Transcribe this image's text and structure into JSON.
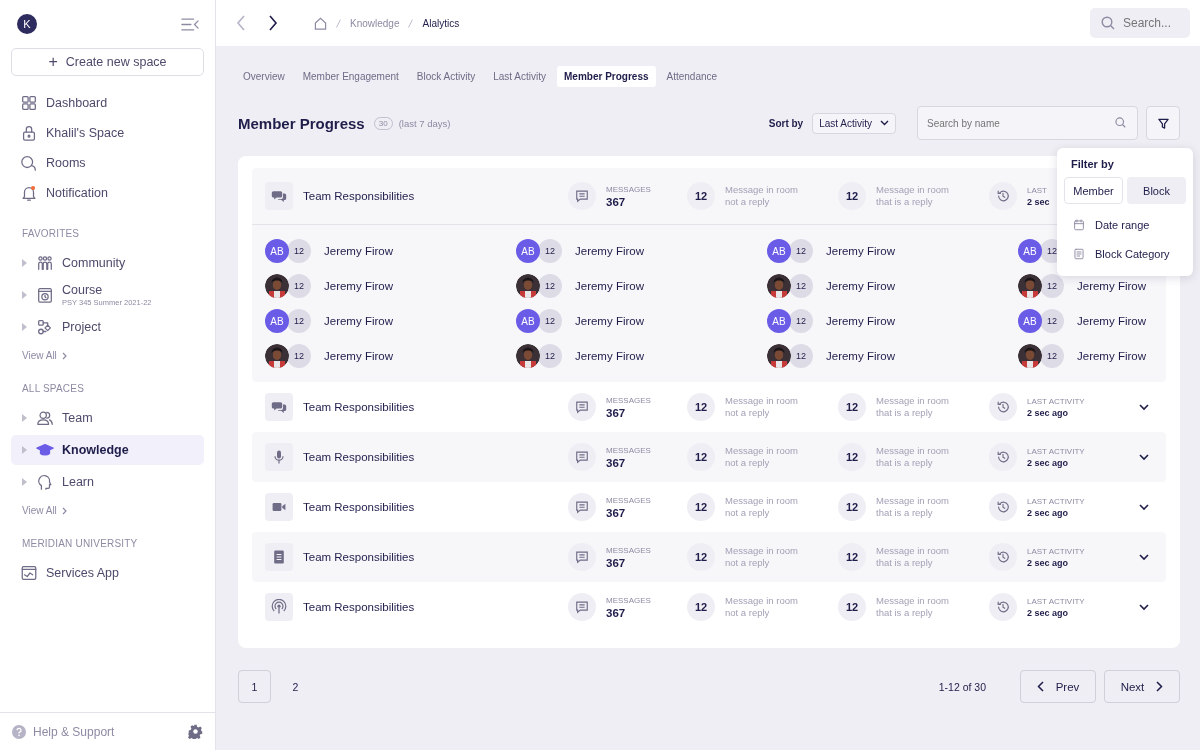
{
  "sidebar": {
    "avatar": "K",
    "create_button": {
      "icon": "+",
      "label": "Create new space"
    },
    "nav": [
      {
        "kind": "dashboard",
        "label": "Dashboard"
      },
      {
        "kind": "lock",
        "label": "Khalil's Space"
      },
      {
        "kind": "rooms",
        "label": "Rooms"
      },
      {
        "kind": "bell",
        "label": "Notification"
      }
    ],
    "sections": [
      {
        "title": "FAVORITES",
        "items": [
          {
            "kind": "community",
            "label": "Community",
            "selected": false
          },
          {
            "kind": "course",
            "label": "Course",
            "subtitle": "PSY 345 Summer 2021-22",
            "selected": false
          },
          {
            "kind": "project",
            "label": "Project",
            "selected": false
          }
        ],
        "view_all": "View All"
      },
      {
        "title": "ALL SPACES",
        "items": [
          {
            "kind": "team",
            "label": "Team",
            "selected": false
          },
          {
            "kind": "knowledge",
            "label": "Knowledge",
            "selected": true
          },
          {
            "kind": "learn",
            "label": "Learn",
            "selected": false
          }
        ],
        "view_all": "View All"
      },
      {
        "title": "MERIDIAN UNIVERSITY",
        "items": [
          {
            "kind": "services",
            "label": "Services App",
            "selected": false
          }
        ]
      }
    ],
    "help": "Help & Support"
  },
  "topbar": {
    "back_disabled": true,
    "breadcrumb": [
      "Knowledge",
      "Alalytics"
    ],
    "search": {
      "placeholder": "Search..."
    }
  },
  "tabs": [
    {
      "label": "Overview",
      "selected": false
    },
    {
      "label": "Member Engagement",
      "selected": false
    },
    {
      "label": "Block Activity",
      "selected": false
    },
    {
      "label": "Last Activity",
      "selected": false
    },
    {
      "label": "Member Progress",
      "selected": true
    },
    {
      "label": "Attendance",
      "selected": false
    }
  ],
  "header": {
    "title": "Member Progress",
    "count": "30",
    "period": "(last 7 days)",
    "sort_label": "Sort by",
    "sort_value": "Last Activity",
    "search": {
      "placeholder": "Search by name"
    }
  },
  "filter_popover": {
    "title": "Filter by",
    "toggles": [
      {
        "label": "Member",
        "selected": true
      },
      {
        "label": "Block",
        "selected": false
      }
    ],
    "items": [
      {
        "kind": "calendar",
        "label": "Date range"
      },
      {
        "kind": "document",
        "label": "Block Category"
      }
    ]
  },
  "blocks": [
    {
      "kind": "chat",
      "title": "Team Responsibilities",
      "messages_label": "MESSAGES",
      "messages": "367",
      "not_reply_count": "12",
      "not_reply_label": "Message in room\nnot a reply",
      "reply_count": "12",
      "reply_label": "Message in room\nthat is a reply",
      "last_activity_label": "LAST",
      "last_activity": "2 sec",
      "expanded": true,
      "members": [
        {
          "kind": "initials",
          "initials": "AB",
          "count": "12",
          "name": "Jeremy Firow"
        },
        {
          "kind": "initials",
          "initials": "AB",
          "count": "12",
          "name": "Jeremy Firow"
        },
        {
          "kind": "initials",
          "initials": "AB",
          "count": "12",
          "name": "Jeremy Firow"
        },
        {
          "kind": "initials",
          "initials": "AB",
          "count": "12"
        },
        {
          "count": "12",
          "name": "Jeremy Firow"
        },
        {
          "count": "12",
          "name": "Jeremy Firow"
        },
        {
          "count": "12",
          "name": "Jeremy Firow"
        },
        {
          "count": "12",
          "name": "Jeremy Firow"
        },
        {
          "kind": "initials",
          "initials": "AB",
          "count": "12",
          "name": "Jeremy Firow"
        },
        {
          "kind": "initials",
          "initials": "AB",
          "count": "12",
          "name": "Jeremy Firow"
        },
        {
          "kind": "initials",
          "initials": "AB",
          "count": "12",
          "name": "Jeremy Firow"
        },
        {
          "kind": "initials",
          "initials": "AB",
          "count": "12",
          "name": "Jeremy Firow"
        },
        {
          "count": "12",
          "name": "Jeremy Firow"
        },
        {
          "count": "12",
          "name": "Jeremy Firow"
        },
        {
          "count": "12",
          "name": "Jeremy Firow"
        },
        {
          "count": "12",
          "name": "Jeremy Firow"
        }
      ]
    },
    {
      "kind": "chat",
      "title": "Team Responsibilities",
      "messages_label": "MESSAGES",
      "messages": "367",
      "not_reply_count": "12",
      "not_reply_label": "Message in room\nnot a reply",
      "reply_count": "12",
      "reply_label": "Message in room\nthat is a reply",
      "last_activity_label": "LAST ACTIVITY",
      "last_activity": "2 sec ago",
      "expanded": false
    },
    {
      "kind": "audio",
      "title": "Team Responsibilities",
      "messages_label": "MESSAGES",
      "messages": "367",
      "not_reply_count": "12",
      "not_reply_label": "Message in room\nnot a reply",
      "reply_count": "12",
      "reply_label": "Message in room\nthat is a reply",
      "last_activity_label": "LAST ACTIVITY",
      "last_activity": "2 sec ago",
      "expanded": false
    },
    {
      "kind": "video",
      "title": "Team Responsibilities",
      "messages_label": "MESSAGES",
      "messages": "367",
      "not_reply_count": "12",
      "not_reply_label": "Message in room\nnot a reply",
      "reply_count": "12",
      "reply_label": "Message in room\nthat is a reply",
      "last_activity_label": "LAST ACTIVITY",
      "last_activity": "2 sec ago",
      "expanded": false
    },
    {
      "kind": "document",
      "title": "Team Responsibilities",
      "messages_label": "MESSAGES",
      "messages": "367",
      "not_reply_count": "12",
      "not_reply_label": "Message in room\nnot a reply",
      "reply_count": "12",
      "reply_label": "Message in room\nthat is a reply",
      "last_activity_label": "LAST ACTIVITY",
      "last_activity": "2 sec ago",
      "expanded": false
    },
    {
      "kind": "broadcast",
      "title": "Team Responsibilities",
      "messages_label": "MESSAGES",
      "messages": "367",
      "not_reply_count": "12",
      "not_reply_label": "Message in room\nnot a reply",
      "reply_count": "12",
      "reply_label": "Message in room\nthat is a reply",
      "last_activity_label": "LAST ACTIVITY",
      "last_activity": "2 sec ago",
      "expanded": false
    }
  ],
  "pagination": {
    "pages": [
      {
        "label": "1",
        "selected": true
      },
      {
        "label": "2",
        "selected": false
      }
    ],
    "range": "1-12 of 30",
    "prev": "Prev",
    "next": "Next"
  }
}
